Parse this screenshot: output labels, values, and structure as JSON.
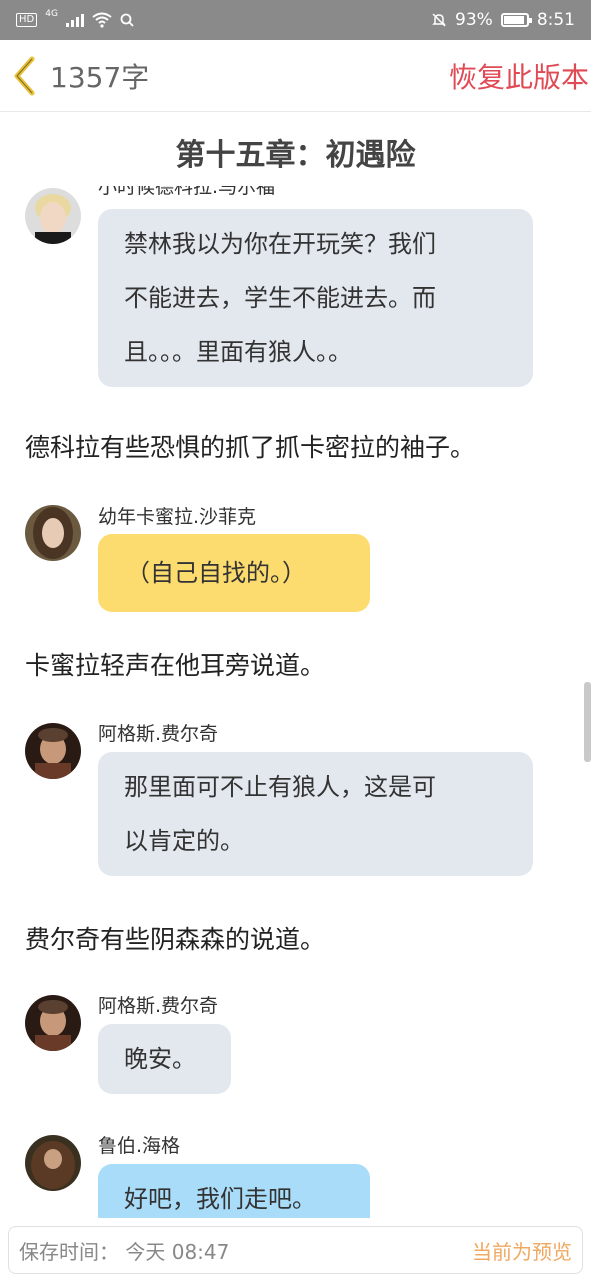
{
  "status_bar": {
    "hd": "HD",
    "network": "4G",
    "battery_text": "93%",
    "battery_level": 0.93,
    "time": "8:51",
    "icons": [
      "signal-icon",
      "wifi-icon",
      "search-icon",
      "mute-icon",
      "battery-icon"
    ]
  },
  "header": {
    "word_count": "1357字",
    "restore_label": "恢复此版本",
    "back_icon": "chevron-left-icon"
  },
  "chapter_title": "第十五章：初遇险",
  "messages": [
    {
      "speaker": "小时候德科拉.马尔福",
      "text": [
        "禁林我以为你在开玩笑？我们",
        "不能进去，学生不能进去。而",
        "且。。。里面有狼人。。"
      ]
    },
    {
      "narration": "德科拉有些恐惧的抓了抓卡密拉的袖子。"
    },
    {
      "speaker": "幼年卡蜜拉.沙菲克",
      "text": [
        "（自己自找的。）"
      ]
    },
    {
      "narration": "卡蜜拉轻声在他耳旁说道。"
    },
    {
      "speaker": "阿格斯.费尔奇",
      "text": [
        "那里面可不止有狼人，这是可",
        "以肯定的。"
      ]
    },
    {
      "narration": "费尔奇有些阴森森的说道。"
    },
    {
      "speaker": "阿格斯.费尔奇",
      "text": [
        "晚安。"
      ]
    },
    {
      "speaker": "鲁伯.海格",
      "text": [
        "好吧，我们走吧。"
      ]
    }
  ],
  "footer": {
    "save_time": "保存时间：  今天 08:47",
    "preview_label": "当前为预览"
  },
  "colors": {
    "accent_red": "#e04a55",
    "bubble_gray": "#e3e8ef",
    "bubble_yellow": "#fddc6f",
    "bubble_blue": "#a9dcf8",
    "preview_orange": "#f0a860",
    "back_chevron": "#e8c13a"
  }
}
